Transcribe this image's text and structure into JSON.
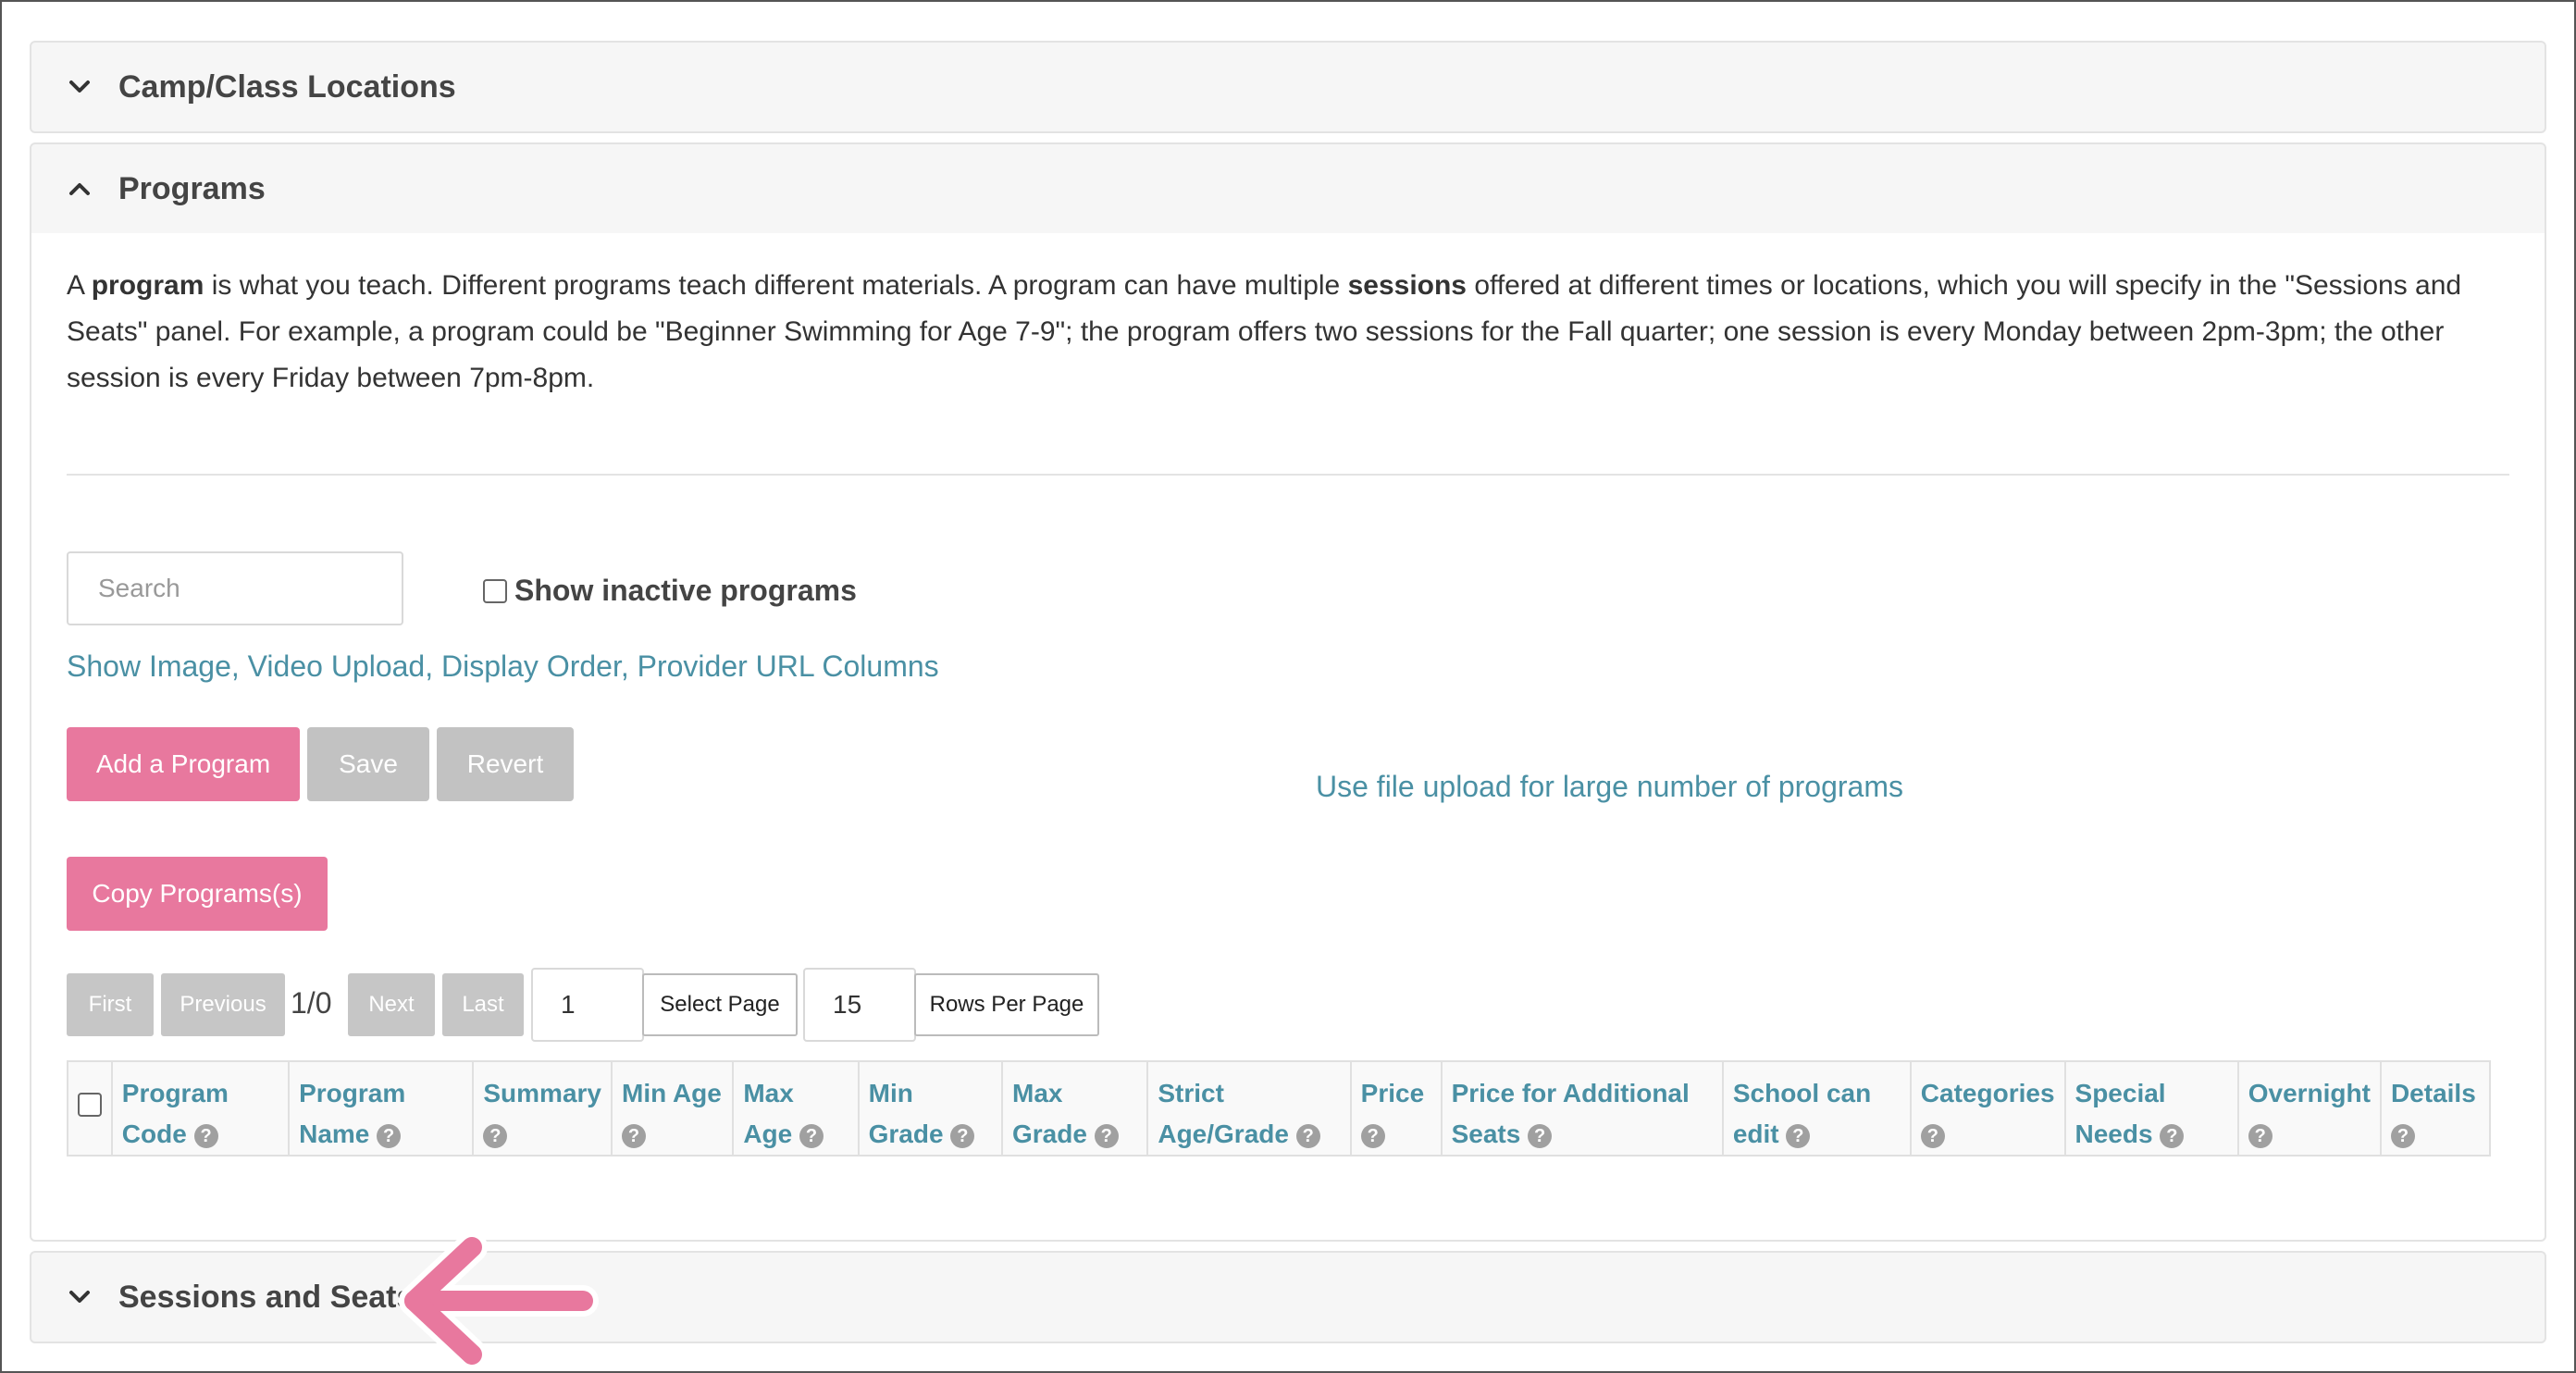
{
  "panels": {
    "locations": {
      "title": "Camp/Class Locations"
    },
    "programs": {
      "title": "Programs"
    },
    "sessions": {
      "title": "Sessions and Seats"
    }
  },
  "intro": {
    "p1": "A ",
    "b1": "program",
    "p2": " is what you teach. Different programs teach different materials. A program can have multiple ",
    "b2": "sessions",
    "p3": " offered at different times or locations, which you will specify in the \"Sessions and Seats\" panel. For example, a program could be \"Beginner Swimming for Age 7-9\"; the program offers two sessions for the Fall quarter; one session is every Monday between 2pm-3pm; the other session is every Friday between 7pm-8pm."
  },
  "search": {
    "placeholder": "Search",
    "value": ""
  },
  "show_inactive": {
    "label": "Show inactive programs",
    "checked": false
  },
  "links": {
    "show_columns": "Show Image, Video Upload, Display Order, Provider URL Columns",
    "file_upload": "Use file upload for large number of programs"
  },
  "buttons": {
    "add": "Add a Program",
    "save": "Save",
    "revert": "Revert",
    "copy": "Copy Programs(s)"
  },
  "pagination": {
    "first": "First",
    "previous": "Previous",
    "status": "1/0",
    "next": "Next",
    "last": "Last",
    "page_value": "1",
    "select_page": "Select Page",
    "rows_value": "15",
    "rows_per_page": "Rows Per Page"
  },
  "help_glyph": "?",
  "table": {
    "columns": [
      {
        "label": "Program Code"
      },
      {
        "label": "Program Name"
      },
      {
        "label": "Summary"
      },
      {
        "label": "Min Age"
      },
      {
        "label": "Max Age"
      },
      {
        "label": "Min Grade"
      },
      {
        "label": "Max Grade"
      },
      {
        "label": "Strict Age/Grade"
      },
      {
        "label": "Price"
      },
      {
        "label": "Price for Additional Seats"
      },
      {
        "label": "School can edit"
      },
      {
        "label": "Categories"
      },
      {
        "label": "Special Needs"
      },
      {
        "label": "Overnight"
      },
      {
        "label": "Details"
      }
    ]
  },
  "colors": {
    "accent_pink": "#e8789e",
    "link_teal": "#4a90a4",
    "disabled_gray": "#c2c2c2"
  }
}
